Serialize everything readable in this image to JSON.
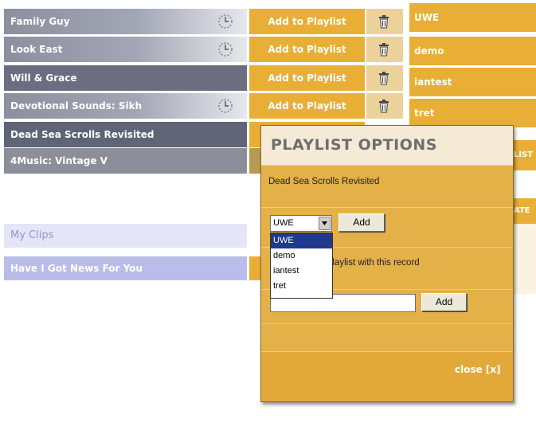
{
  "programmes": [
    {
      "title": "Family Guy",
      "has_clock": true,
      "action": "Add to Playlist"
    },
    {
      "title": "Look East",
      "has_clock": true,
      "action": "Add to Playlist"
    },
    {
      "title": "Will & Grace",
      "has_clock": false,
      "action": "Add to Playlist"
    },
    {
      "title": "Devotional Sounds: Sikh",
      "has_clock": true,
      "action": "Add to Playlist"
    },
    {
      "title": "Dead Sea Scrolls Revisited"
    },
    {
      "title": "4Music: Vintage V"
    }
  ],
  "playlists": [
    "UWE",
    "demo",
    "iantest",
    "tret"
  ],
  "behind_modal_fragments": {
    "list_tab": "LIST",
    "update_tab": "ATE"
  },
  "my_clips": {
    "heading": "My Clips",
    "items": [
      "Have I Got News For You"
    ]
  },
  "modal": {
    "title": "PLAYLIST OPTIONS",
    "record_name": "Dead Sea Scrolls Revisited",
    "select_value": "UWE",
    "add_label": "Add",
    "create_text": "playlist with this record",
    "add2_label": "Add",
    "close_label": "close [x]",
    "options": [
      "UWE",
      "demo",
      "iantest",
      "tret"
    ]
  },
  "icons": {
    "clock": "clock-icon",
    "trash": "trash-icon",
    "dropdown": "chevron-down-icon"
  },
  "colors": {
    "accent": "#e8ae36",
    "row_dark": "#6a6e80",
    "row_grey": "#8c8f99",
    "clips_bg": "#b9bde8",
    "modal_head": "#f5ead6"
  }
}
